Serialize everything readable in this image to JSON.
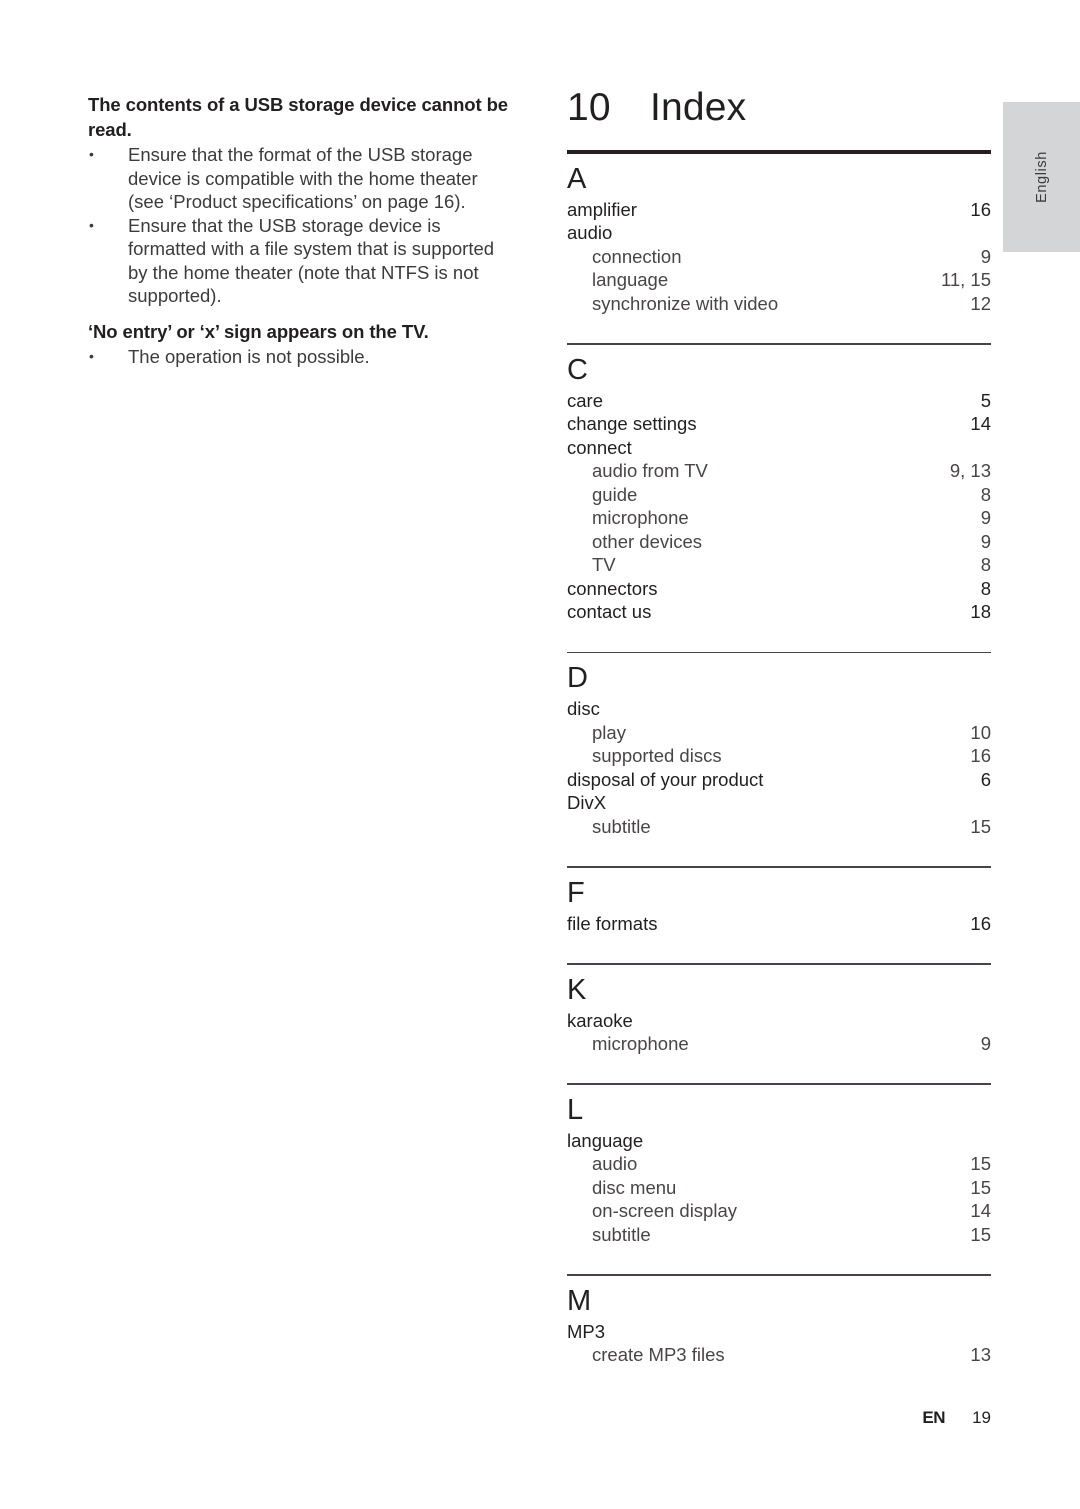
{
  "language_tab": {
    "label": "English"
  },
  "left_column": {
    "blocks": [
      {
        "type": "heading",
        "text": "The contents of a USB storage device cannot be read."
      },
      {
        "type": "bullet",
        "marker": "•",
        "text": "Ensure that the format of the USB storage device is compatible with the home theater (see ‘Product specifications’ on page 16)."
      },
      {
        "type": "bullet",
        "marker": "•",
        "text": "Ensure that the USB storage device is formatted with a file system that is supported by the home theater (note that NTFS is not supported)."
      },
      {
        "type": "heading",
        "text": "‘No entry’ or ‘x’ sign appears on the TV."
      },
      {
        "type": "bullet",
        "marker": "•",
        "text": "The operation is not possible."
      }
    ]
  },
  "index": {
    "chapter_number": "10",
    "title": "Index",
    "sections": [
      {
        "letter": "A",
        "entries": [
          {
            "label": "amplifier",
            "page": "16",
            "level": 0
          },
          {
            "label": "audio",
            "page": "",
            "level": 0
          },
          {
            "label": "connection",
            "page": "9",
            "level": 1
          },
          {
            "label": "language",
            "page": "11, 15",
            "level": 1
          },
          {
            "label": "synchronize with video",
            "page": "12",
            "level": 1
          }
        ]
      },
      {
        "letter": "C",
        "entries": [
          {
            "label": "care",
            "page": "5",
            "level": 0
          },
          {
            "label": "change settings",
            "page": "14",
            "level": 0
          },
          {
            "label": "connect",
            "page": "",
            "level": 0
          },
          {
            "label": "audio from TV",
            "page": "9, 13",
            "level": 1
          },
          {
            "label": "guide",
            "page": "8",
            "level": 1
          },
          {
            "label": "microphone",
            "page": "9",
            "level": 1
          },
          {
            "label": "other devices",
            "page": "9",
            "level": 1
          },
          {
            "label": "TV",
            "page": "8",
            "level": 1
          },
          {
            "label": "connectors",
            "page": "8",
            "level": 0
          },
          {
            "label": "contact us",
            "page": "18",
            "level": 0
          }
        ]
      },
      {
        "letter": "D",
        "entries": [
          {
            "label": "disc",
            "page": "",
            "level": 0
          },
          {
            "label": "play",
            "page": "10",
            "level": 1
          },
          {
            "label": "supported discs",
            "page": "16",
            "level": 1
          },
          {
            "label": "disposal of your product",
            "page": "6",
            "level": 0
          },
          {
            "label": "DivX",
            "page": "",
            "level": 0
          },
          {
            "label": "subtitle",
            "page": "15",
            "level": 1
          }
        ]
      },
      {
        "letter": "F",
        "entries": [
          {
            "label": "file formats",
            "page": "16",
            "level": 0
          }
        ]
      },
      {
        "letter": "K",
        "entries": [
          {
            "label": "karaoke",
            "page": "",
            "level": 0
          },
          {
            "label": "microphone",
            "page": "9",
            "level": 1
          }
        ]
      },
      {
        "letter": "L",
        "entries": [
          {
            "label": "language",
            "page": "",
            "level": 0
          },
          {
            "label": "audio",
            "page": "15",
            "level": 1
          },
          {
            "label": "disc menu",
            "page": "15",
            "level": 1
          },
          {
            "label": "on-screen display",
            "page": "14",
            "level": 1
          },
          {
            "label": "subtitle",
            "page": "15",
            "level": 1
          }
        ]
      },
      {
        "letter": "M",
        "entries": [
          {
            "label": "MP3",
            "page": "",
            "level": 0
          },
          {
            "label": "create MP3 files",
            "page": "13",
            "level": 1
          }
        ]
      }
    ]
  },
  "footer": {
    "locale": "EN",
    "page_number": "19"
  },
  "colors": {
    "text": "#231f20",
    "body_text": "#3b3b3d",
    "rule": "#4a4248",
    "tab_background": "#d4d5d7"
  }
}
